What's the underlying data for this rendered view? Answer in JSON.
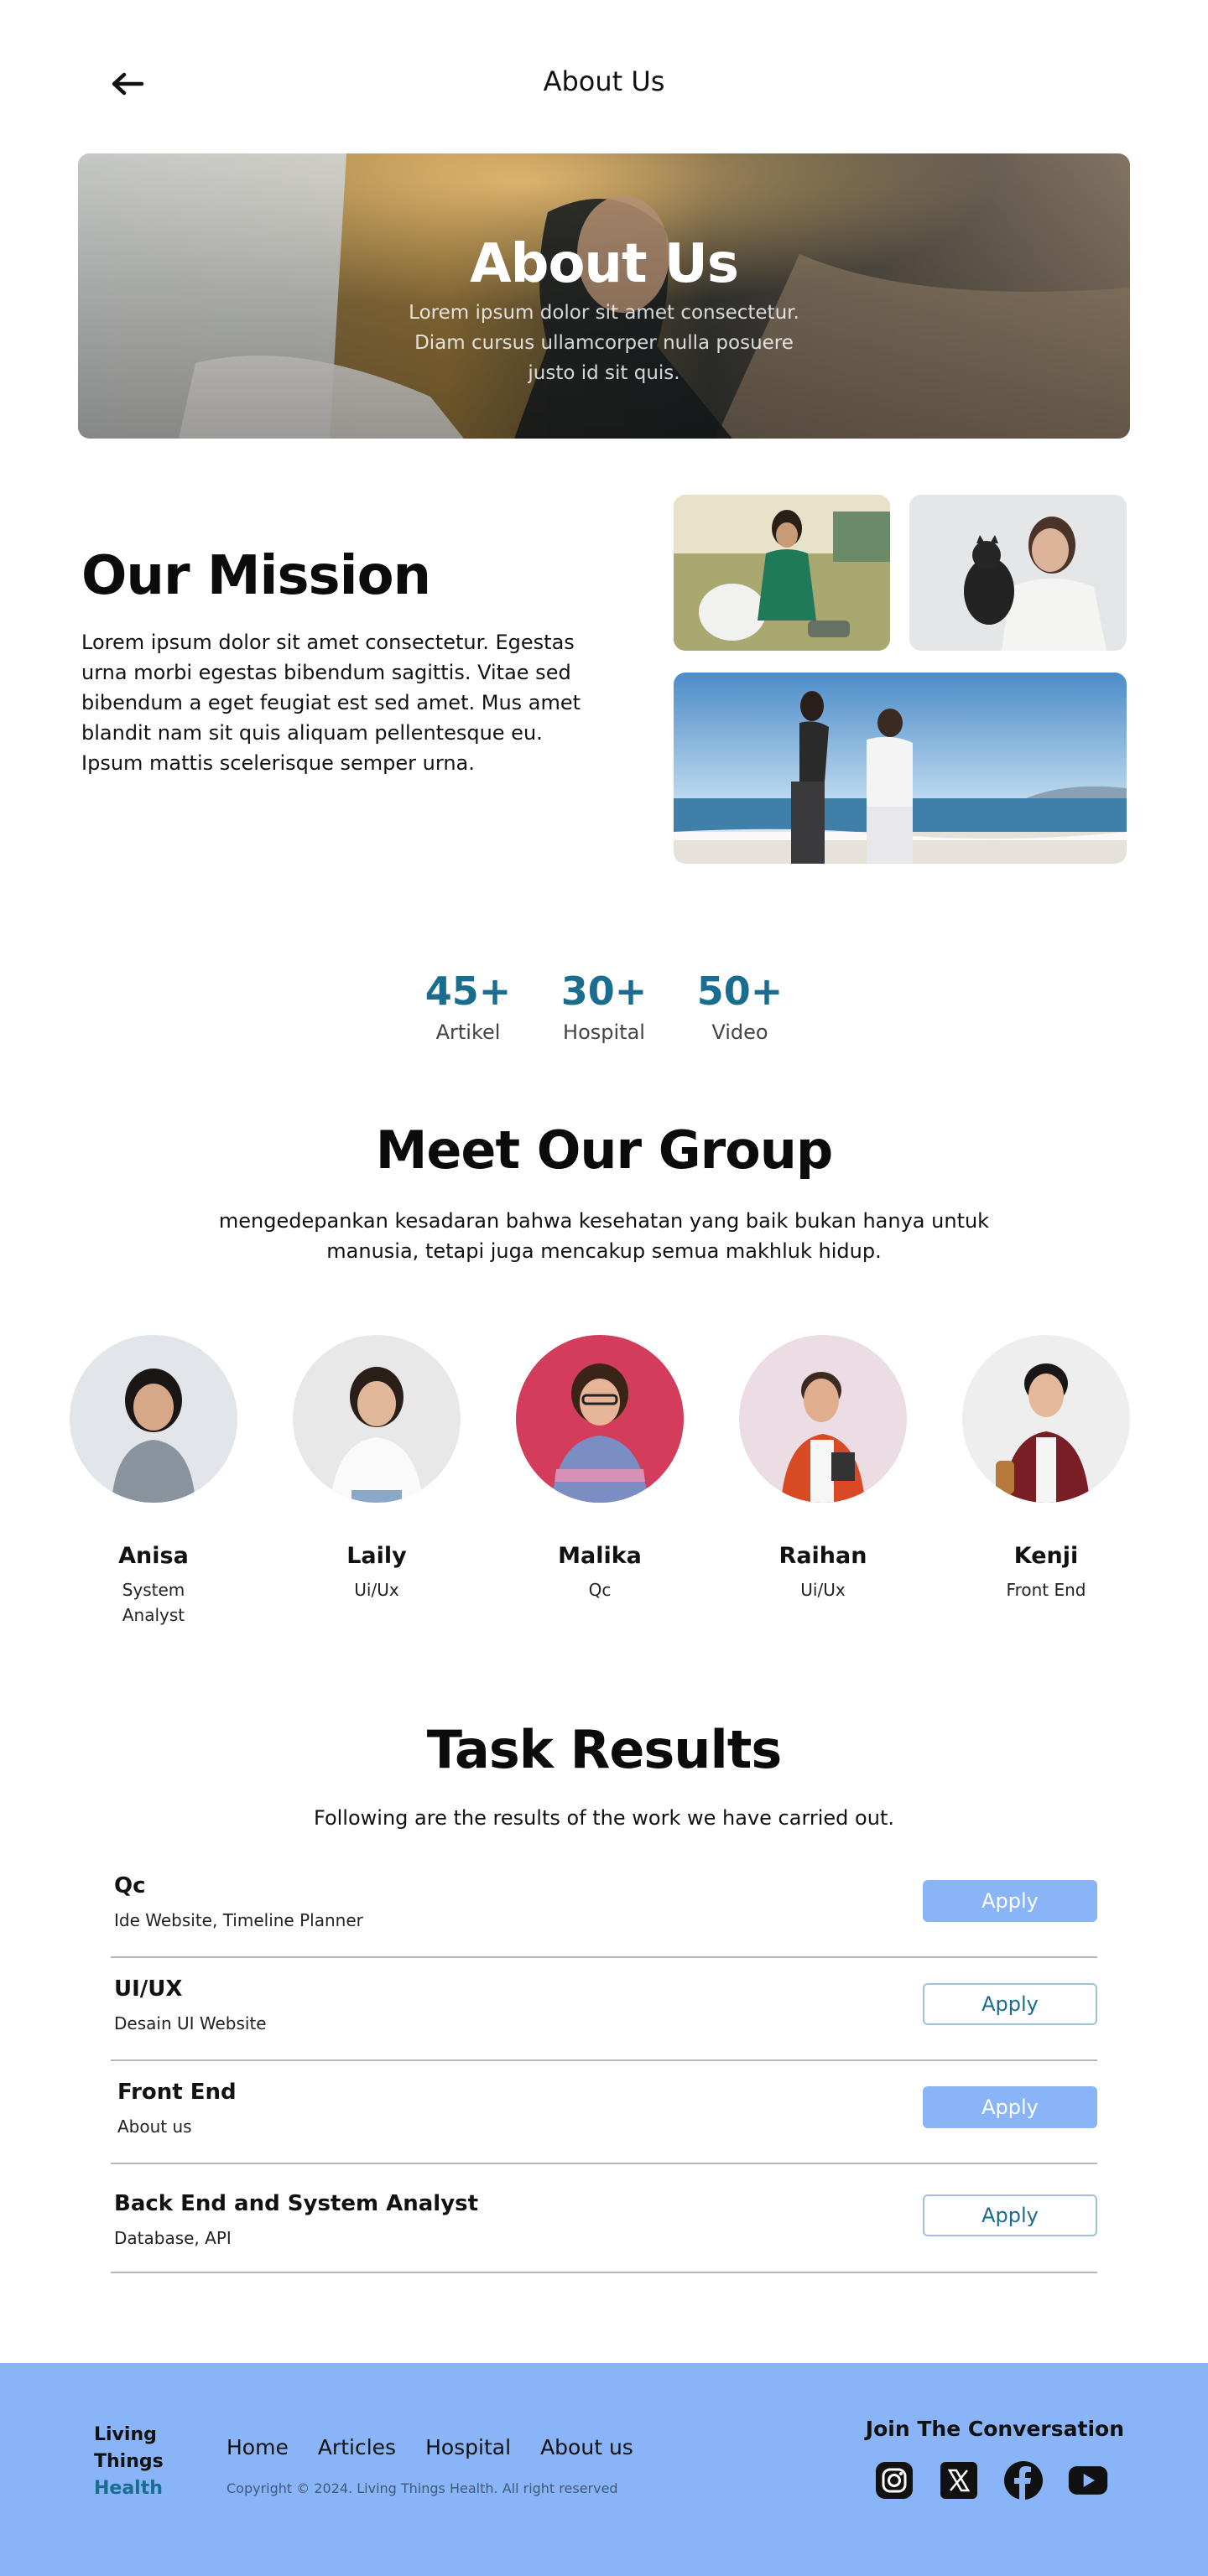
{
  "header": {
    "title": "About Us"
  },
  "hero": {
    "title": "About Us",
    "subtitle": "Lorem ipsum dolor sit amet consectetur. Diam cursus ullamcorper nulla posuere justo id sit quis."
  },
  "mission": {
    "title": "Our Mission",
    "text": "Lorem ipsum dolor sit amet consectetur. Egestas urna morbi egestas bibendum sagittis. Vitae sed bibendum a eget feugiat est sed amet. Mus amet blandit nam sit quis aliquam pellentesque eu. Ipsum mattis scelerisque semper urna."
  },
  "stats": [
    {
      "value": "45+",
      "label": "Artikel"
    },
    {
      "value": "30+",
      "label": "Hospital"
    },
    {
      "value": "50+",
      "label": "Video"
    }
  ],
  "group": {
    "title": "Meet Our Group",
    "subtitle": "mengedepankan kesadaran bahwa kesehatan yang baik bukan hanya untuk manusia, tetapi juga mencakup semua makhluk hidup.",
    "members": [
      {
        "name": "Anisa",
        "role": "System Analyst"
      },
      {
        "name": "Laily",
        "role": "Ui/Ux"
      },
      {
        "name": "Malika",
        "role": "Qc"
      },
      {
        "name": "Raihan",
        "role": "Ui/Ux"
      },
      {
        "name": "Kenji",
        "role": "Front End"
      }
    ]
  },
  "tasks": {
    "title": "Task Results",
    "subtitle": "Following are the results of the work we have carried out.",
    "items": [
      {
        "name": "Qc",
        "desc": "Ide Website, Timeline Planner",
        "button": "Apply"
      },
      {
        "name": "UI/UX",
        "desc": "Desain UI Website",
        "button": "Apply"
      },
      {
        "name": "Front End",
        "desc": "About us",
        "button": "Apply"
      },
      {
        "name": "Back End and System Analyst",
        "desc": "Database, API",
        "button": "Apply"
      }
    ]
  },
  "footer": {
    "brand_line1": "Living",
    "brand_line2": "Things",
    "brand_line3": "Health",
    "nav": [
      "Home",
      "Articles",
      "Hospital",
      "About us"
    ],
    "copyright": "Copyright © 2024. Living Things Health. All right reserved",
    "join": "Join The Conversation",
    "socials": [
      "instagram-icon",
      "x-icon",
      "facebook-icon",
      "youtube-icon"
    ]
  },
  "colors": {
    "accent": "#1a6d8e",
    "button_blue": "#8ab4f8",
    "footer_bg": "#8ab4f8"
  }
}
